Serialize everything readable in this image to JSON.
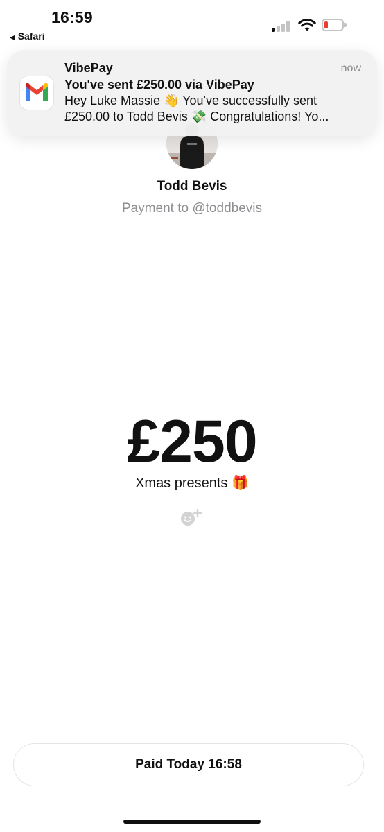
{
  "status_bar": {
    "time": "16:59",
    "back_app": "Safari",
    "back_arrow": "◀"
  },
  "notification": {
    "app_name": "VibePay",
    "time": "now",
    "title": "You've sent £250.00 via VibePay",
    "body_line1": "Hey Luke Massie 👋 You've successfully sent",
    "body_line2": "£250.00 to Todd Bevis 💸 Congratulations! Yo...",
    "icon": "gmail-icon"
  },
  "payment": {
    "recipient_name": "Todd Bevis",
    "recipient_handle": "Payment to @toddbevis",
    "amount": "£250",
    "note": "Xmas presents 🎁",
    "status": "Paid Today 16:58"
  },
  "colors": {
    "battery_low": "#ee3b30",
    "handle_gray": "#8e8e93"
  }
}
